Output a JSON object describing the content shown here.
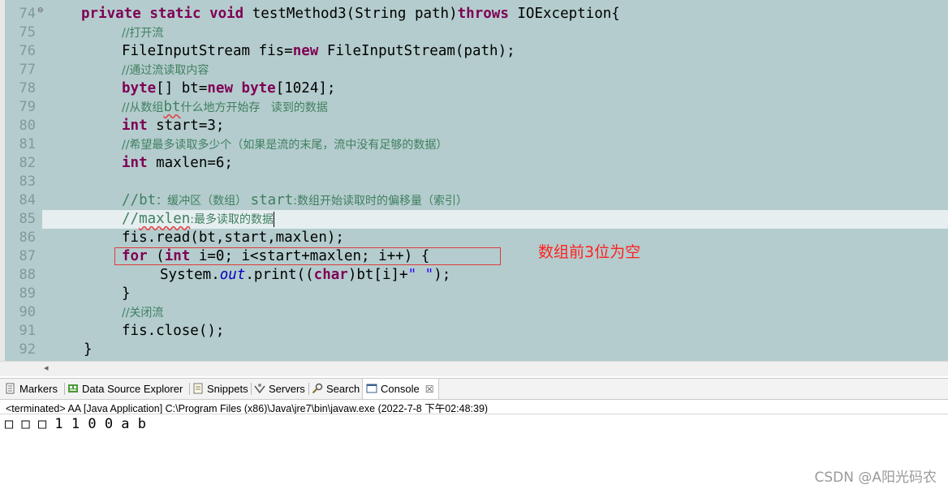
{
  "editor": {
    "fold_marker": "⊖",
    "annotation": "数组前3位为空",
    "line_numbers": [
      "74",
      "75",
      "76",
      "77",
      "78",
      "79",
      "80",
      "81",
      "82",
      "83",
      "84",
      "85",
      "86",
      "87",
      "88",
      "89",
      "90",
      "91",
      "92"
    ],
    "lines": {
      "l74": {
        "a": "private",
        "b": "static",
        "c": "void",
        "d": " testMethod3(String path)",
        "e": "throws",
        "f": " IOException{"
      },
      "l75": {
        "a": "//打开流"
      },
      "l76": {
        "a": "FileInputStream fis=",
        "b": "new",
        "c": " FileInputStream(path);"
      },
      "l77": {
        "a": "//通过流读取内容"
      },
      "l78": {
        "a": "byte",
        "b": "[] bt=",
        "c": "new",
        "d": " ",
        "e": "byte",
        "f": "[1024];"
      },
      "l79": {
        "a": "//从数组",
        "b": "bt",
        "c": "什么地方开始存   读到的数据"
      },
      "l80": {
        "a": "int",
        "b": " start=3;"
      },
      "l81": {
        "a": "//希望最多读取多少个（如果是流的末尾，流中没有足够的数据）"
      },
      "l82": {
        "a": "int",
        "b": " maxlen=6;"
      },
      "l84": {
        "a": "//",
        "b": "bt",
        "c": "：缓冲区（数组） ",
        "d": "start",
        "e": ":数组开始读取时的偏移量（索引）"
      },
      "l85": {
        "a": "//",
        "b": "maxlen",
        "c": ":最多读取的数据"
      },
      "l86": {
        "a": "fis.read(bt,start,maxlen);"
      },
      "l87": {
        "a": "for",
        "b": " (",
        "c": "int",
        "d": " i=0; i<start+maxlen; i++) {"
      },
      "l88": {
        "a": "System.",
        "b": "out",
        "c": ".print((",
        "d": "char",
        "e": ")bt[i]+",
        "f": "\" \"",
        "g": ");"
      },
      "l89": {
        "a": "}"
      },
      "l90": {
        "a": "//关闭流"
      },
      "l91": {
        "a": "fis.close();"
      },
      "l92": {
        "a": "}"
      }
    }
  },
  "tabs": [
    {
      "label": "Markers",
      "icon": "markers-icon"
    },
    {
      "label": "Data Source Explorer",
      "icon": "data-source-icon"
    },
    {
      "label": "Snippets",
      "icon": "snippets-icon"
    },
    {
      "label": "Servers",
      "icon": "servers-icon"
    },
    {
      "label": "Search",
      "icon": "search-icon"
    },
    {
      "label": "Console",
      "icon": "console-icon",
      "active": true,
      "close": "☒"
    }
  ],
  "console": {
    "status": "<terminated> AA [Java Application] C:\\Program Files (x86)\\Java\\jre7\\bin\\javaw.exe (2022-7-8 下午02:48:39)",
    "output": "□ □ □ 1 1 0 0 a b"
  },
  "watermark": "CSDN @A阳光码农",
  "colors": {
    "keyword": "#7f0055",
    "comment": "#3f7f5f",
    "string": "#2a00ff",
    "field": "#0000c0",
    "annotation": "#ff2020",
    "editor_bg": "#b4cccd"
  }
}
